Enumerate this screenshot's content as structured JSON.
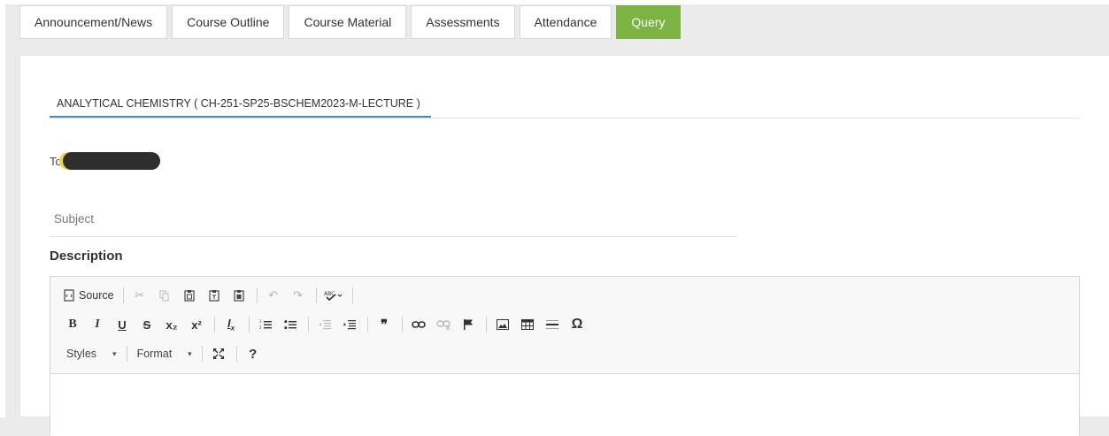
{
  "tabs": [
    {
      "label": "Announcement/News",
      "active": false
    },
    {
      "label": "Course Outline",
      "active": false
    },
    {
      "label": "Course Material",
      "active": false
    },
    {
      "label": "Assessments",
      "active": false
    },
    {
      "label": "Attendance",
      "active": false
    },
    {
      "label": "Query",
      "active": true
    }
  ],
  "colors": {
    "active_tab": "#7cb342",
    "sub_tab_underline": "#3d8ed8"
  },
  "course": {
    "title": "ANALYTICAL CHEMISTRY ( CH-251-SP25-BSCHEM2023-M-LECTURE )"
  },
  "form": {
    "to_label": "To:",
    "subject_placeholder": "Subject",
    "description_label": "Description"
  },
  "editor": {
    "source_label": "Source",
    "styles_label": "Styles",
    "format_label": "Format",
    "icons": {
      "source": "source-icon",
      "cut": "cut-icon",
      "copy": "copy-icon",
      "paste": "paste-icon",
      "paste_text": "paste-text-icon",
      "paste_word": "paste-word-icon",
      "undo": "undo-icon",
      "redo": "redo-icon",
      "spellcheck": "spellcheck-icon",
      "bold": "B",
      "italic": "I",
      "underline": "U",
      "strike": "S",
      "subscript": "x₂",
      "superscript": "x²",
      "remove_format": "Ix",
      "numbered_list": "numbered-list-icon",
      "bulleted_list": "bulleted-list-icon",
      "outdent": "outdent-icon",
      "indent": "indent-icon",
      "blockquote": "❞",
      "link": "link-icon",
      "unlink": "unlink-icon",
      "anchor": "anchor-flag-icon",
      "image": "image-icon",
      "table": "table-icon",
      "hr": "horizontal-line-icon",
      "special_char": "Ω",
      "maximize": "maximize-icon",
      "help": "?"
    }
  }
}
